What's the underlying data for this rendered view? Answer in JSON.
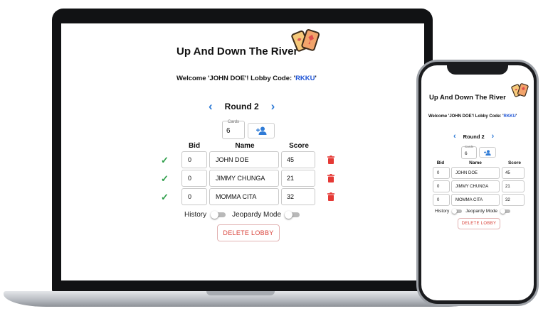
{
  "app": {
    "title": "Up And Down The River",
    "welcome_prefix": "Welcome 'JOHN DOE'! Lobby Code: '",
    "lobby_code": "RKKU",
    "welcome_suffix": "'",
    "round_label": "Round 2",
    "cards_caption": "Cards",
    "cards_value": "6",
    "columns": {
      "bid": "Bid",
      "name": "Name",
      "score": "Score"
    },
    "players": [
      {
        "bid": "0",
        "name": "JOHN DOE",
        "score": "45"
      },
      {
        "bid": "0",
        "name": "JIMMY CHUNGA",
        "score": "21"
      },
      {
        "bid": "0",
        "name": "MOMMA CITA",
        "score": "32"
      }
    ],
    "history_label": "History",
    "jeopardy_label": "Jeopardy Mode",
    "delete_label": "DELETE LOBBY"
  },
  "colors": {
    "accent": "#2f7bd6",
    "lobby_code": "#1f55d6",
    "check": "#2e9e4a",
    "delete": "#d9433b",
    "trash": "#e53935"
  },
  "icons": {
    "logo": "playing-cards-icon",
    "prev": "chevron-left-icon",
    "next": "chevron-right-icon",
    "add_player": "add-person-icon",
    "row_check": "check-icon",
    "row_delete": "trash-icon"
  }
}
